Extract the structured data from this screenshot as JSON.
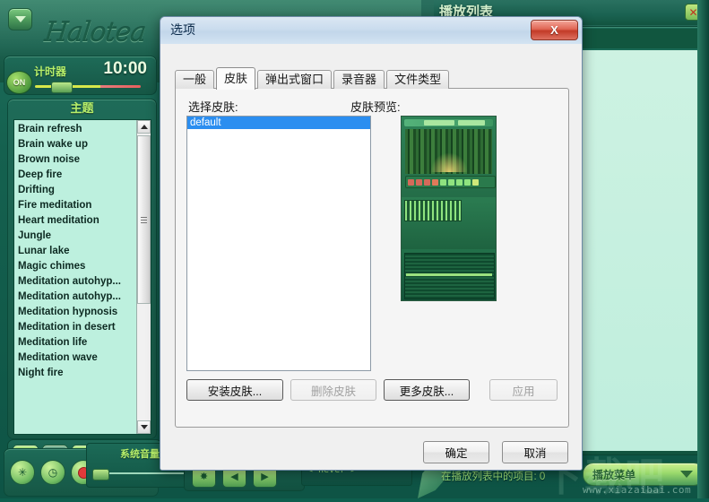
{
  "app": {
    "logo_text": "Halotea",
    "dropdown_icon": "chevron-down-icon",
    "timer": {
      "label": "计时器",
      "value": "10:00",
      "toggle_state": "ON"
    },
    "theme_panel": {
      "title": "主题",
      "items": [
        "Brain refresh",
        "Brain wake up",
        "Brown noise",
        "Deep fire",
        "Drifting",
        "Fire meditation",
        "Heart meditation",
        "Jungle",
        "Lunar lake",
        "Magic chimes",
        "Meditation autohyp...",
        "Meditation autohyp...",
        "Meditation hypnosis",
        "Meditation in desert",
        "Meditation life",
        "Meditation wave",
        "Night fire"
      ]
    },
    "toolbar_icons": [
      {
        "name": "new-document-icon",
        "glyph": "📄"
      },
      {
        "name": "stop-icon",
        "glyph": "■"
      },
      {
        "name": "music-note-icon",
        "glyph": "♫"
      },
      {
        "name": "save-icon",
        "glyph": "💾"
      },
      {
        "name": "fade-icon",
        "glyph": "◢"
      }
    ],
    "bottom_icons": [
      {
        "name": "settings-gear-icon",
        "glyph": "✳"
      },
      {
        "name": "clock-icon",
        "glyph": "◷"
      },
      {
        "name": "record-icon",
        "glyph": ""
      }
    ],
    "volume": {
      "label": "系统音量"
    },
    "transport_icons": [
      {
        "name": "shuffle-icon",
        "glyph": "✸"
      },
      {
        "name": "previous-track-icon",
        "glyph": "◀"
      },
      {
        "name": "next-track-icon",
        "glyph": "▶"
      }
    ],
    "now_playing": "< never >"
  },
  "playlist_panel": {
    "title": "播放列表",
    "close_icon": "close-icon",
    "close_glyph": "✕",
    "item_count_label": "在播放列表中的项目: 0",
    "menu_button_label": "播放菜单",
    "menu_dropdown_icon": "chevron-down-icon"
  },
  "watermark": {
    "big_text": "下载吧",
    "url": "www.xiazaibai.com"
  },
  "dialog": {
    "title": "选项",
    "close_label": "X",
    "close_icon": "close-icon",
    "tabs": [
      {
        "label": "一般",
        "active": false
      },
      {
        "label": "皮肤",
        "active": true
      },
      {
        "label": "弹出式窗口",
        "active": false
      },
      {
        "label": "录音器",
        "active": false
      },
      {
        "label": "文件类型",
        "active": false
      }
    ],
    "skin_tab": {
      "select_label": "选择皮肤:",
      "preview_label": "皮肤预览:",
      "skins": [
        "default"
      ],
      "selected_skin": "default",
      "buttons": {
        "install": "安装皮肤...",
        "delete": "删除皮肤",
        "more": "更多皮肤...",
        "apply": "应用"
      }
    },
    "footer": {
      "ok": "确定",
      "cancel": "取消"
    }
  },
  "colors": {
    "accent_green": "#b8f06a",
    "panel_green": "#1e6b58",
    "selection_blue": "#2b8ef0",
    "close_red": "#c23a27"
  }
}
